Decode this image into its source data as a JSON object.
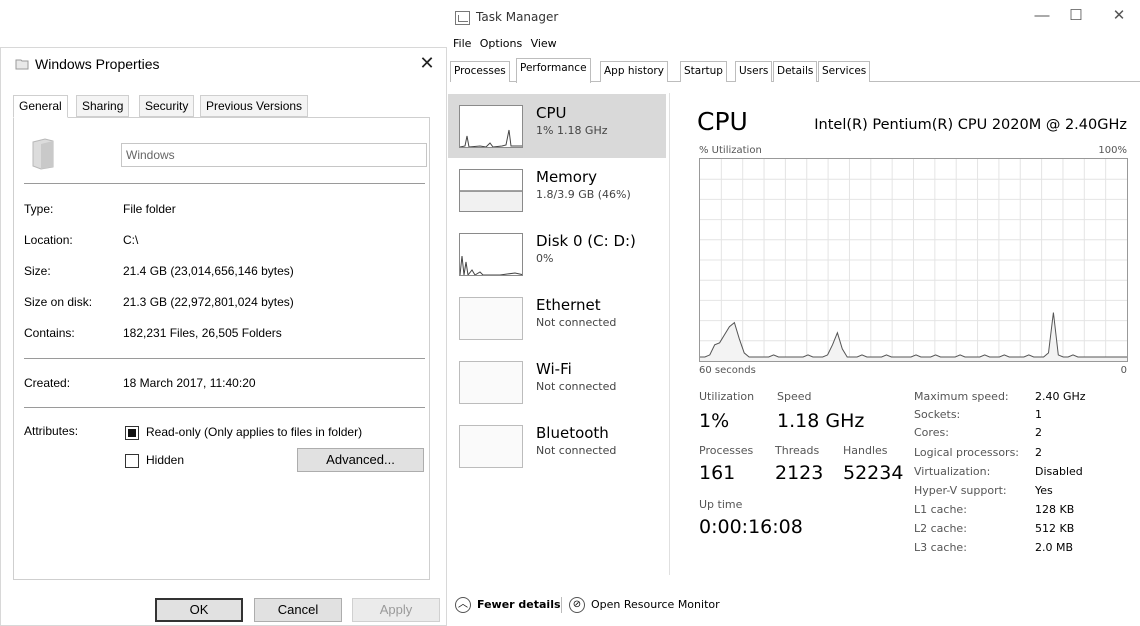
{
  "props": {
    "title": "Windows Properties",
    "tabs": [
      "General",
      "Sharing",
      "Security",
      "Previous Versions"
    ],
    "name": "Windows",
    "rows": [
      {
        "label": "Type:",
        "value": "File folder"
      },
      {
        "label": "Location:",
        "value": "C:\\"
      },
      {
        "label": "Size:",
        "value": "21.4 GB (23,014,656,146 bytes)"
      },
      {
        "label": "Size on disk:",
        "value": "21.3 GB (22,972,801,024 bytes)"
      },
      {
        "label": "Contains:",
        "value": "182,231 Files, 26,505 Folders"
      }
    ],
    "created_label": "Created:",
    "created_value": "18 March 2017, 11:40:20",
    "attributes_label": "Attributes:",
    "readonly_label": "Read-only (Only applies to files in folder)",
    "hidden_label": "Hidden",
    "advanced_label": "Advanced...",
    "ok_label": "OK",
    "cancel_label": "Cancel",
    "apply_label": "Apply"
  },
  "tm": {
    "title": "Task Manager",
    "menu": [
      "File",
      "Options",
      "View"
    ],
    "tabs": [
      "Processes",
      "Performance",
      "App history",
      "Startup",
      "Users",
      "Details",
      "Services"
    ],
    "sidebar": [
      {
        "name": "CPU",
        "sub": "1% 1.18 GHz"
      },
      {
        "name": "Memory",
        "sub": "1.8/3.9 GB (46%)"
      },
      {
        "name": "Disk 0 (C: D:)",
        "sub": "0%"
      },
      {
        "name": "Ethernet",
        "sub": "Not connected"
      },
      {
        "name": "Wi-Fi",
        "sub": "Not connected"
      },
      {
        "name": "Bluetooth",
        "sub": "Not connected"
      }
    ],
    "main_title": "CPU",
    "processor": "Intel(R) Pentium(R) CPU 2020M @ 2.40GHz",
    "util_label": "% Utilization",
    "util_max": "100%",
    "time_label": "60 seconds",
    "time_min": "0",
    "stats": {
      "utilization_label": "Utilization",
      "utilization": "1%",
      "speed_label": "Speed",
      "speed": "1.18 GHz",
      "processes_label": "Processes",
      "processes": "161",
      "threads_label": "Threads",
      "threads": "2123",
      "handles_label": "Handles",
      "handles": "52234",
      "uptime_label": "Up time",
      "uptime": "0:00:16:08"
    },
    "specs": [
      {
        "k": "Maximum speed:",
        "v": "2.40 GHz"
      },
      {
        "k": "Sockets:",
        "v": "1"
      },
      {
        "k": "Cores:",
        "v": "2"
      },
      {
        "k": "Logical processors:",
        "v": "2"
      },
      {
        "k": "Virtualization:",
        "v": "Disabled"
      },
      {
        "k": "Hyper-V support:",
        "v": "Yes"
      },
      {
        "k": "L1 cache:",
        "v": "128 KB"
      },
      {
        "k": "L2 cache:",
        "v": "512 KB"
      },
      {
        "k": "L3 cache:",
        "v": "2.0 MB"
      }
    ],
    "fewer_details": "Fewer details",
    "resource_monitor": "Open Resource Monitor",
    "cpu_history": [
      2,
      2,
      3,
      8,
      9,
      13,
      17,
      19,
      11,
      4,
      2,
      2,
      2,
      2,
      2,
      3,
      2,
      2,
      2,
      2,
      2,
      2,
      3,
      2,
      2,
      2,
      3,
      8,
      14,
      6,
      2,
      2,
      2,
      3,
      2,
      2,
      2,
      2,
      3,
      2,
      2,
      2,
      2,
      2,
      3,
      2,
      2,
      2,
      3,
      2,
      2,
      2,
      2,
      3,
      2,
      2,
      2,
      2,
      3,
      2,
      2,
      2,
      3,
      2,
      2,
      2,
      2,
      3,
      2,
      2,
      2,
      4,
      24,
      3,
      2,
      2,
      3,
      2,
      2,
      2,
      2,
      2,
      2,
      2,
      2,
      2,
      2,
      2
    ]
  }
}
